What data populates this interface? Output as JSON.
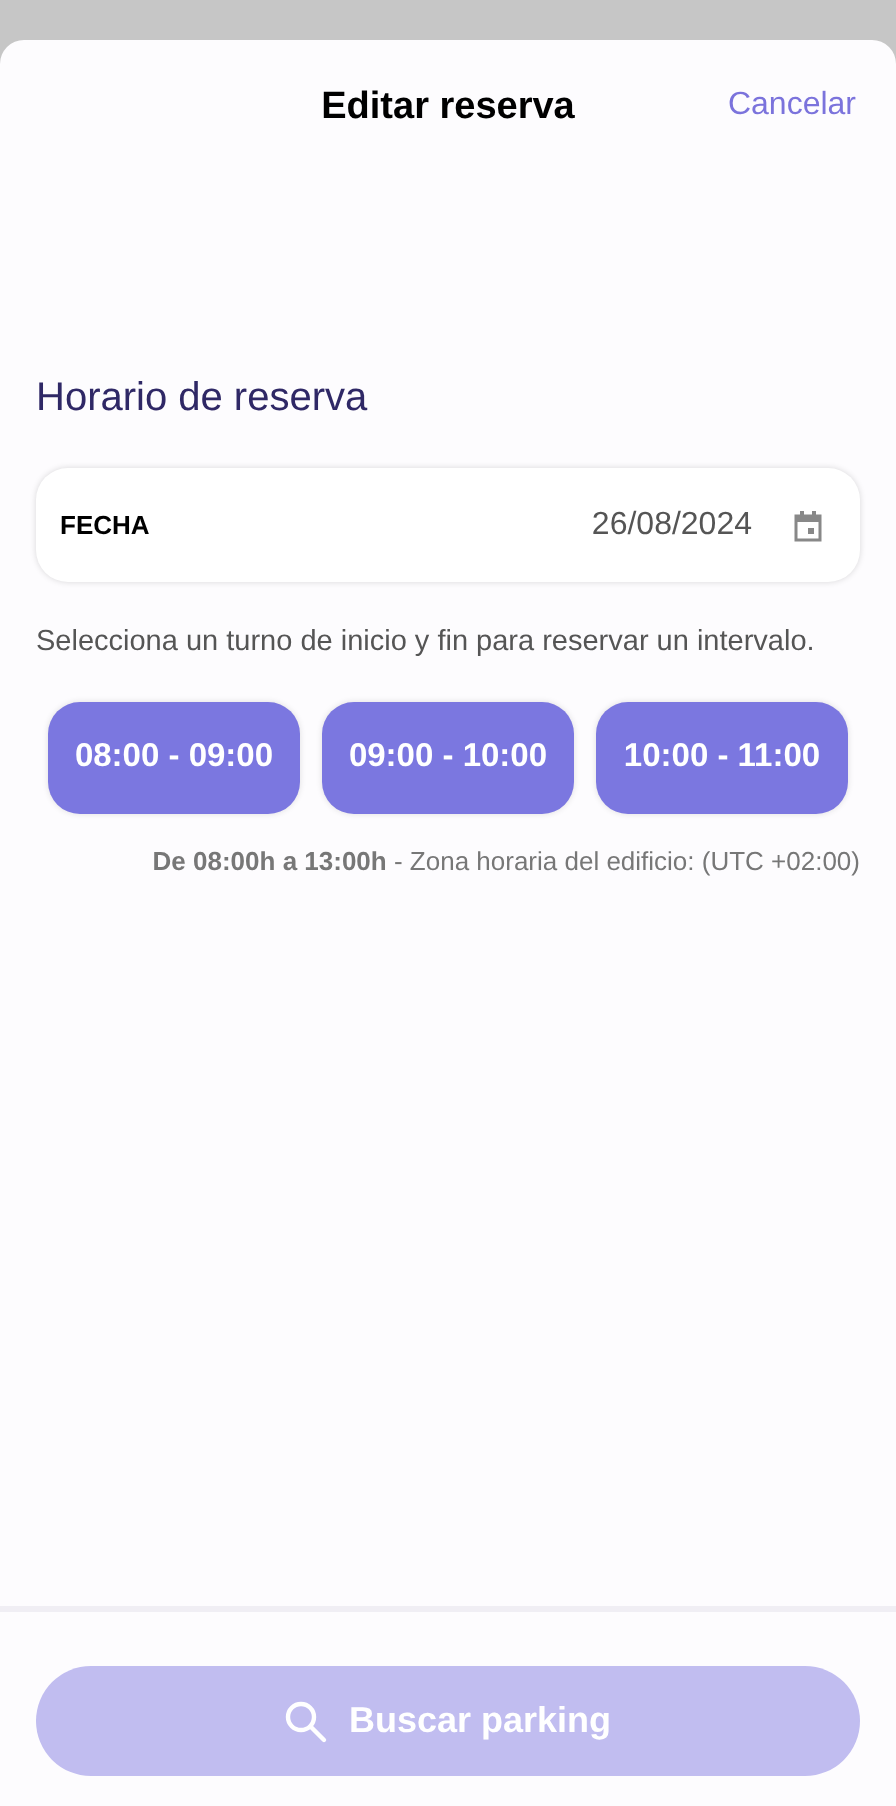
{
  "header": {
    "title": "Editar reserva",
    "cancel": "Cancelar"
  },
  "section_title": "Horario de reserva",
  "date_field": {
    "label": "FECHA",
    "value": "26/08/2024"
  },
  "hint": "Selecciona un turno de inicio y fin para reservar un intervalo.",
  "slots": [
    {
      "label": "08:00 - 09:00",
      "selected": false
    },
    {
      "label": "09:00 - 10:00",
      "selected": false
    },
    {
      "label": "10:00 - 11:00",
      "selected": false
    }
  ],
  "note": "**De 08:00h a 13:00h** - Zona horaria del edificio: (UTC +02:00)",
  "search_button": {
    "label": "Buscar parking",
    "disabled": true
  }
}
